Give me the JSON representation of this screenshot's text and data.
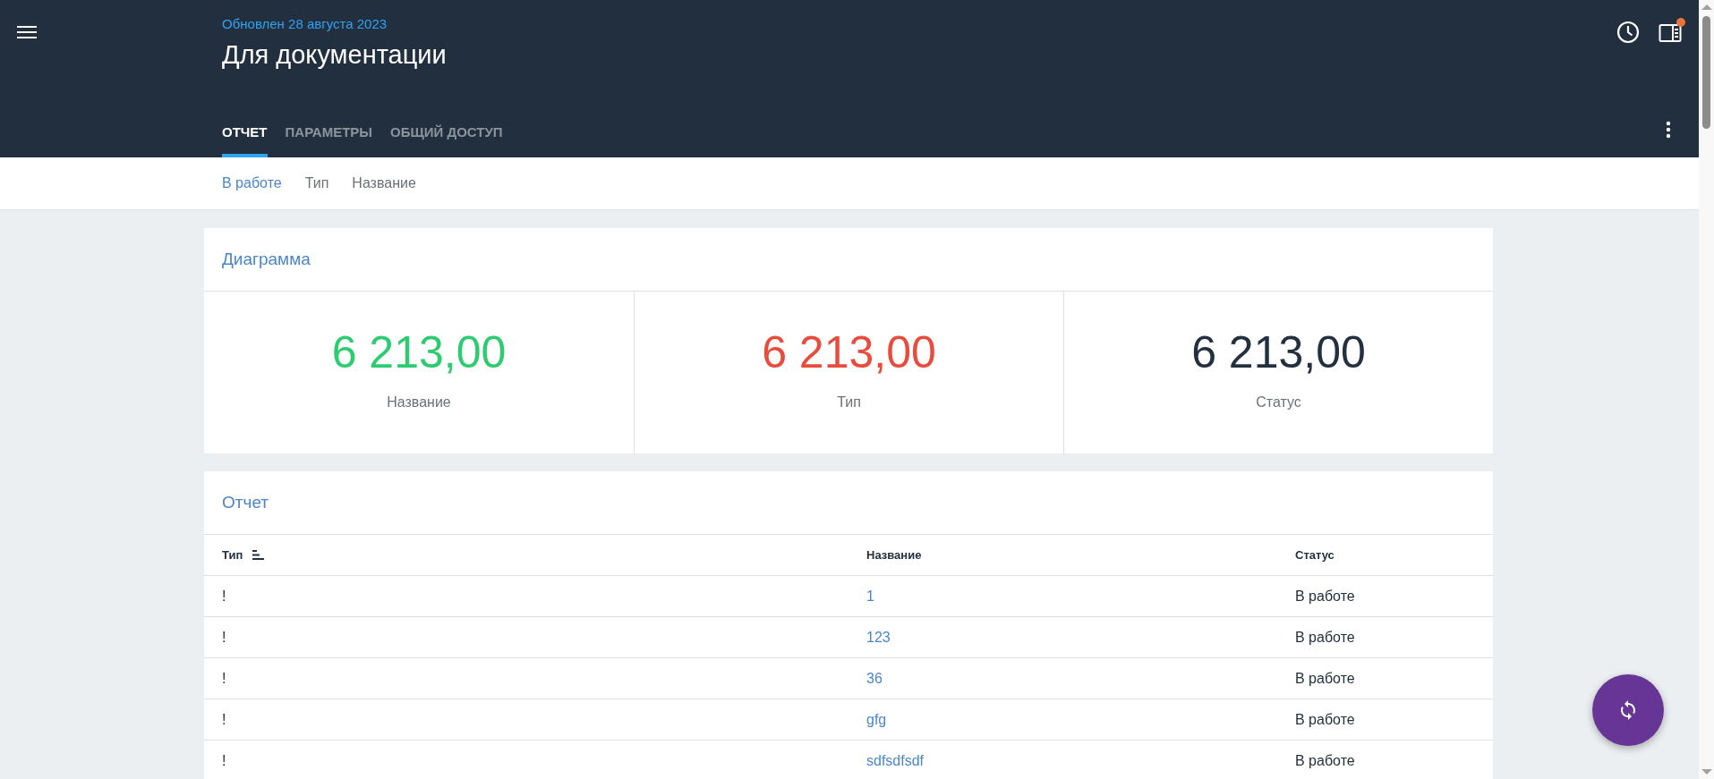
{
  "header": {
    "updated": "Обновлен 28 августа 2023",
    "title": "Для документации",
    "notification": true
  },
  "tabs": [
    {
      "label": "ОТЧЕТ",
      "selected": true
    },
    {
      "label": "ПАРАМЕТРЫ",
      "selected": false
    },
    {
      "label": "ОБЩИЙ ДОСТУП",
      "selected": false
    }
  ],
  "filters": [
    {
      "label": "В работе",
      "selected": true
    },
    {
      "label": "Тип",
      "selected": false
    },
    {
      "label": "Название",
      "selected": false
    }
  ],
  "summary": {
    "title": "Диаграмма",
    "stats": [
      {
        "value": "6 213,00",
        "label": "Название",
        "color": "#2ecc71"
      },
      {
        "value": "6 213,00",
        "label": "Тип",
        "color": "#e74c3c"
      },
      {
        "value": "6 213,00",
        "label": "Статус",
        "color": "#22303f"
      }
    ]
  },
  "table": {
    "title": "Отчет",
    "columns": [
      {
        "label": "Тип",
        "sorted": true
      },
      {
        "label": "Название",
        "sorted": false
      },
      {
        "label": "Статус",
        "sorted": false
      }
    ],
    "rows": [
      [
        "!",
        "1",
        "В работе"
      ],
      [
        "!",
        "123",
        "В работе"
      ],
      [
        "!",
        "36",
        "В работе"
      ],
      [
        "!",
        "gfg",
        "В работе"
      ],
      [
        "!",
        "sdfsdfsdf",
        "В работе"
      ]
    ]
  }
}
